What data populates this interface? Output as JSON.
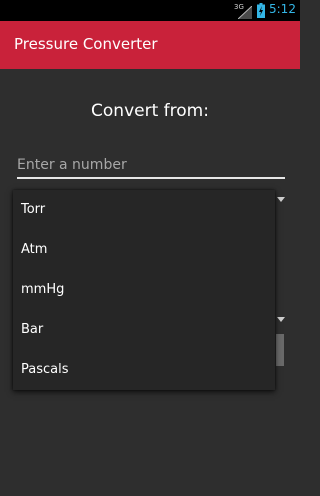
{
  "status_bar": {
    "network": "3G",
    "time": "5:12"
  },
  "app_bar": {
    "title": "Pressure Converter",
    "color": "#c9223a"
  },
  "main": {
    "heading": "Convert from:",
    "input": {
      "value": "",
      "placeholder": "Enter a number"
    }
  },
  "dropdown": {
    "options": [
      {
        "label": "Torr"
      },
      {
        "label": "Atm"
      },
      {
        "label": "mmHg"
      },
      {
        "label": "Bar"
      },
      {
        "label": "Pascals"
      }
    ]
  }
}
